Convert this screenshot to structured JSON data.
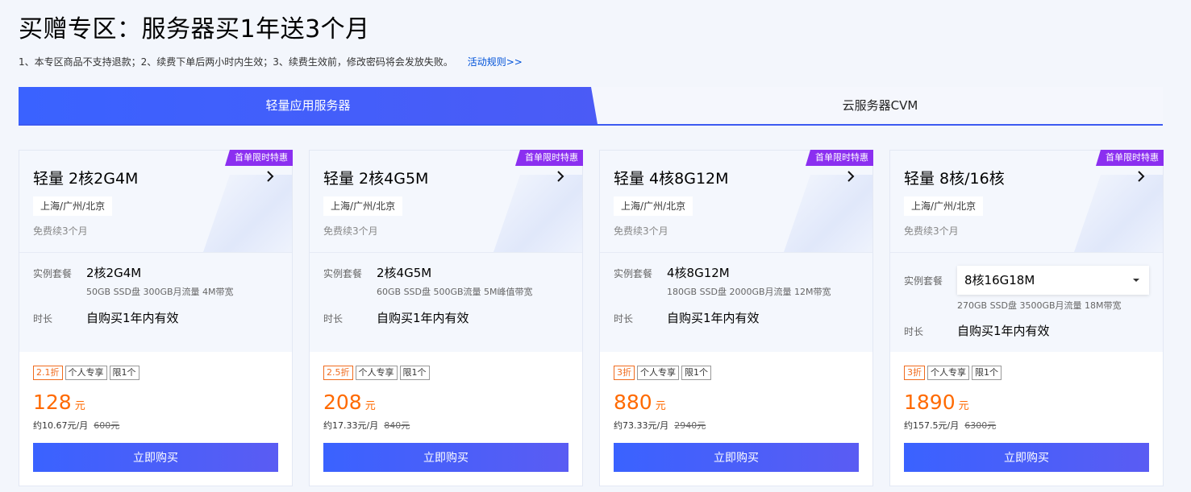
{
  "header": {
    "title": "买赠专区：服务器买1年送3个月",
    "notice": "1、本专区商品不支持退款；2、续费下单后两小时内生效；3、续费生效前，修改密码将会发放失败。",
    "rules_link": "活动规则>>"
  },
  "tabs": [
    {
      "label": "轻量应用服务器",
      "active": true
    },
    {
      "label": "云服务器CVM",
      "active": false
    }
  ],
  "labels": {
    "package": "实例套餐",
    "duration": "时长",
    "buy": "立即购买"
  },
  "cards": [
    {
      "badge": "首单限时特惠",
      "title": "轻量 2核2G4M",
      "region": "上海/广州/北京",
      "renew": "免费续3个月",
      "package": "2核2G4M",
      "package_detail": "50GB SSD盘 300GB月流量 4M带宽",
      "duration": "自购买1年内有效",
      "tags": [
        "2.1折",
        "个人专享",
        "限1个"
      ],
      "price": "128",
      "price_unit": "元",
      "monthly": "约10.67元/月",
      "original": "600元"
    },
    {
      "badge": "首单限时特惠",
      "title": "轻量 2核4G5M",
      "region": "上海/广州/北京",
      "renew": "免费续3个月",
      "package": "2核4G5M",
      "package_detail": "60GB SSD盘 500GB流量 5M峰值带宽",
      "duration": "自购买1年内有效",
      "tags": [
        "2.5折",
        "个人专享",
        "限1个"
      ],
      "price": "208",
      "price_unit": "元",
      "monthly": "约17.33元/月",
      "original": "840元"
    },
    {
      "badge": "首单限时特惠",
      "title": "轻量 4核8G12M",
      "region": "上海/广州/北京",
      "renew": "免费续3个月",
      "package": "4核8G12M",
      "package_detail": "180GB SSD盘 2000GB月流量 12M带宽",
      "duration": "自购买1年内有效",
      "tags": [
        "3折",
        "个人专享",
        "限1个"
      ],
      "price": "880",
      "price_unit": "元",
      "monthly": "约73.33元/月",
      "original": "2940元"
    },
    {
      "badge": "首单限时特惠",
      "title": "轻量 8核/16核",
      "region": "上海/广州/北京",
      "renew": "免费续3个月",
      "package": "8核16G18M",
      "package_detail": "270GB SSD盘 3500GB月流量 18M带宽",
      "duration": "自购买1年内有效",
      "tags": [
        "3折",
        "个人专享",
        "限1个"
      ],
      "price": "1890",
      "price_unit": "元",
      "monthly": "约157.5元/月",
      "original": "6300元"
    }
  ],
  "icons": {
    "chevron": "chevron-right-icon",
    "caret": "caret-down-icon"
  },
  "colors": {
    "accent": "#3a62ff",
    "badge": "#8b2ff0",
    "price": "#ff6a00",
    "link": "#0052d9"
  }
}
